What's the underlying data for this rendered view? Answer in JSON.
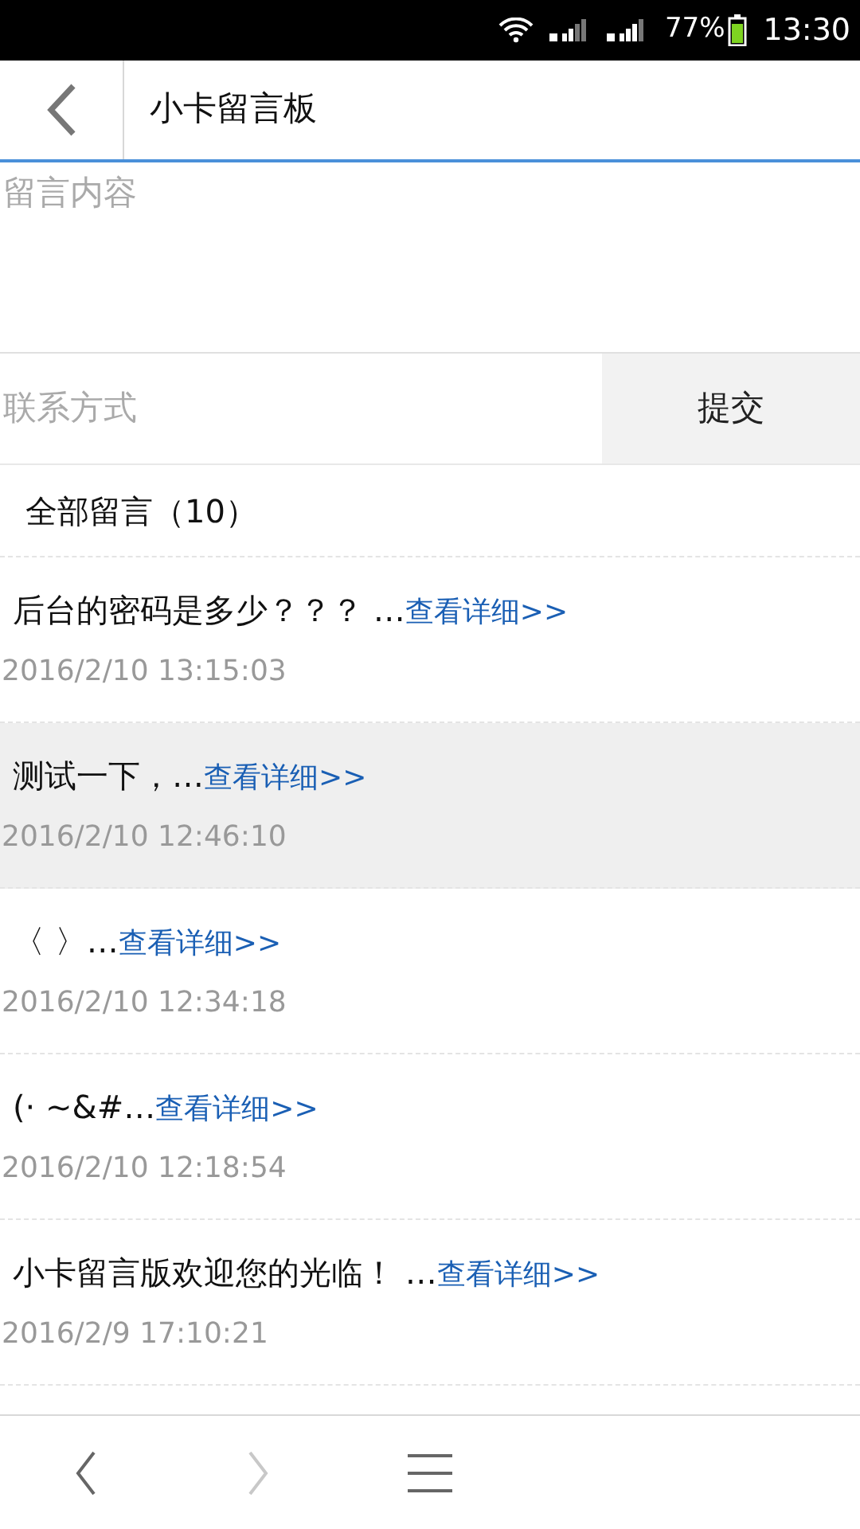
{
  "status_bar": {
    "battery_text": "77%",
    "time": "13:30"
  },
  "header": {
    "title": "小卡留言板"
  },
  "form": {
    "message_placeholder": "留言内容",
    "contact_placeholder": "联系方式",
    "submit": "提交"
  },
  "list_heading": "全部留言（10）",
  "messages": [
    {
      "text": "后台的密码是多少？？？ …",
      "link": "查看详细>>",
      "time": "2016/2/10 13:15:03",
      "selected": false
    },
    {
      "text": "测试一下，…",
      "link": "查看详细>>",
      "time": "2016/2/10 12:46:10",
      "selected": true
    },
    {
      "text": "〈 〉…",
      "link": "查看详细>>",
      "time": "2016/2/10 12:34:18",
      "selected": false
    },
    {
      "text": "(· ~&#…",
      "link": "查看详细>>",
      "time": "2016/2/10 12:18:54",
      "selected": false
    },
    {
      "text": "小卡留言版欢迎您的光临！ …",
      "link": "查看详细>>",
      "time": "2016/2/9 17:10:21",
      "selected": false
    }
  ],
  "browser_bar": {
    "back_disabled": false,
    "forward_disabled": true
  }
}
